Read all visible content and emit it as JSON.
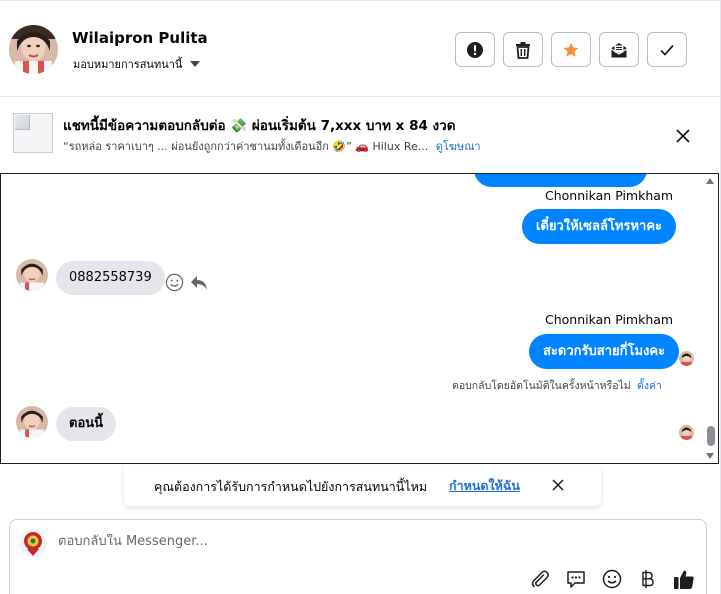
{
  "header": {
    "contact_name": "Wilaipron Pulita",
    "assign_label": "มอบหมายการสนทนานี้",
    "actions": [
      {
        "name": "report-icon",
        "label": "Report"
      },
      {
        "name": "trash-icon",
        "label": "Delete"
      },
      {
        "name": "star-icon",
        "label": "Star"
      },
      {
        "name": "mark-unread-icon",
        "label": "Mark unread"
      },
      {
        "name": "check-icon",
        "label": "Done"
      }
    ],
    "star_color": "#f7923b"
  },
  "ad": {
    "title": "แชทนี้มีข้อความตอบกลับต่อ 💸 ผ่อนเริ่มต้น 7,xxx บาท x 84 งวด",
    "subtitle": "“รถหล่อ ราคาเบาๆ ... ผ่อนยังถูกกว่าค่าชานมทั้งเดือนอีก 🤣” 🚗 Hilux Re...",
    "link": "ดูโฆษณา"
  },
  "conversation": {
    "sender_1": "Chonnikan Pimkham",
    "outgoing_1": "เดี๋ยวให้เซลล์โทรหาคะ",
    "incoming_1": "0882558739",
    "sender_2": "Chonnikan Pimkham",
    "outgoing_2": "สะดวกรับสายกี่โมงคะ",
    "auto_reply_note": "ตอบกลับโดยอัตโนมัติในครั้งหน้าหรือไม่",
    "auto_reply_link": "ตั้งค่า",
    "incoming_2": "ตอนนี้"
  },
  "assign_prompt": {
    "text": "คุณต้องการได้รับการกำหนดไปยังการสนทนานี้ไหม",
    "link": "กำหนดให้ฉัน"
  },
  "composer": {
    "placeholder": "ตอบกลับใน Messenger...",
    "value": "",
    "icons": [
      "attach-icon",
      "saved-replies-icon",
      "emoji-icon",
      "baht-icon",
      "like-icon"
    ],
    "like_color": "#0084ff"
  },
  "colors": {
    "accent": "#0084ff",
    "link": "#216fdb",
    "incoming_bubble": "#e4e6eb"
  }
}
